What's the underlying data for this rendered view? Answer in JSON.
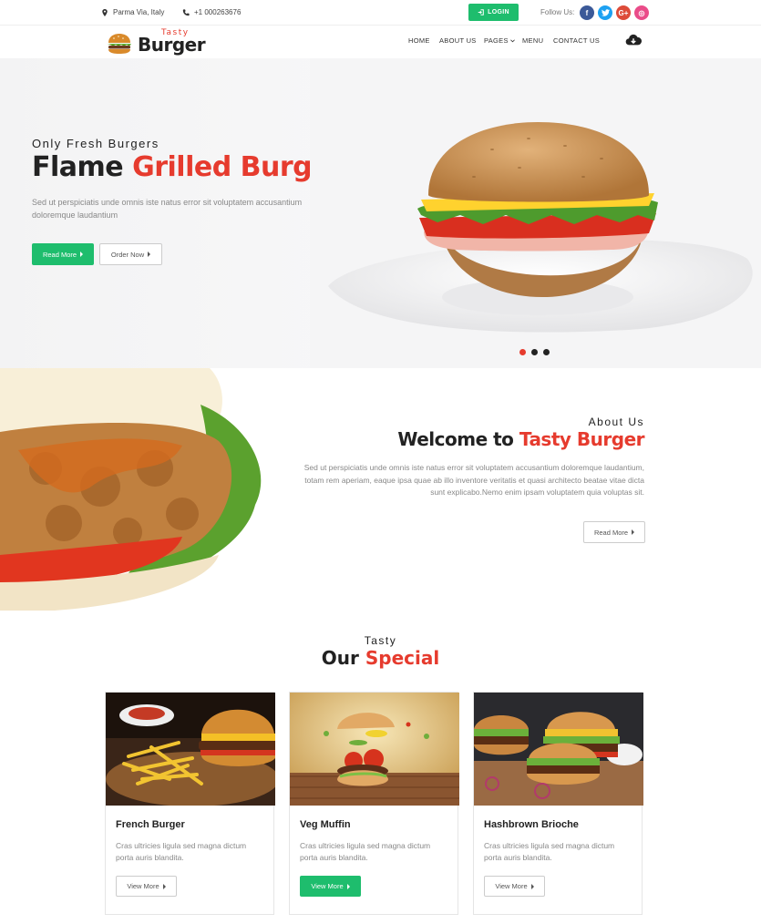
{
  "topbar": {
    "location": "Parma Via, Italy",
    "phone": "+1 000263676",
    "login_label": "LOGIN",
    "follow_label": "Follow Us:",
    "social": [
      {
        "name": "facebook",
        "glyph": "f",
        "color": "#3b5998"
      },
      {
        "name": "twitter",
        "glyph": "t",
        "color": "#1da1f2"
      },
      {
        "name": "google-plus",
        "glyph": "G+",
        "color": "#dd4b39"
      },
      {
        "name": "dribbble",
        "glyph": "◎",
        "color": "#ea4c89"
      }
    ]
  },
  "nav": {
    "logo_small": "Tasty",
    "logo_name": "Burger",
    "items": [
      "HOME",
      "ABOUT US",
      "PAGES",
      "MENU",
      "CONTACT US"
    ]
  },
  "hero": {
    "subtitle": "Only Fresh Burgers",
    "title_plain": "Flame ",
    "title_accent": "Grilled Burger",
    "description": "Sed ut perspiciatis unde omnis iste natus error sit voluptatem accusantium doloremque laudantium",
    "primary_button": "Read More",
    "secondary_button": "Order Now",
    "slider_dots": 3,
    "active_dot": 1
  },
  "about": {
    "subtitle": "About Us",
    "title_plain": "Welcome to ",
    "title_accent": "Tasty Burger",
    "description": "Sed ut perspiciatis unde omnis iste natus error sit voluptatem accusantium doloremque laudantium, totam rem aperiam, eaque ipsa quae ab illo inventore veritatis et quasi architecto beatae vitae dicta sunt explicabo.Nemo enim ipsam voluptatem quia voluptas sit.",
    "button": "Read More"
  },
  "special": {
    "subtitle": "Tasty",
    "title_plain": "Our ",
    "title_accent": "Special",
    "cards": [
      {
        "title": "French Burger",
        "description": "Cras ultricies ligula sed magna dictum porta auris blandita.",
        "button": "View More",
        "highlight": false
      },
      {
        "title": "Veg Muffin",
        "description": "Cras ultricies ligula sed magna dictum porta auris blandita.",
        "button": "View More",
        "highlight": true
      },
      {
        "title": "Hashbrown Brioche",
        "description": "Cras ultricies ligula sed magna dictum porta auris blandita.",
        "button": "View More",
        "highlight": false
      }
    ]
  },
  "colors": {
    "accent_red": "#e63b2e",
    "accent_green": "#1ebd6d",
    "text_dark": "#222222",
    "text_muted": "#888888"
  }
}
